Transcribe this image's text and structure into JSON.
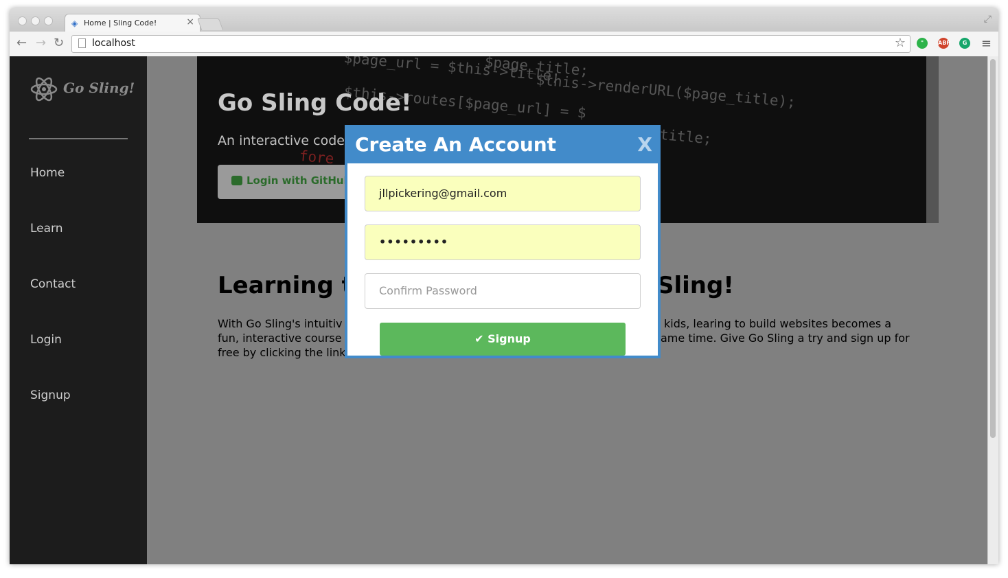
{
  "browser": {
    "tab_title": "Home | Sling Code!",
    "tab_close": "×",
    "url": "localhost",
    "extensions": [
      {
        "name": "hangouts-icon",
        "label": "",
        "color": "#2db34a"
      },
      {
        "name": "adblock-icon",
        "label": "ABP",
        "color": "#d0442c"
      },
      {
        "name": "grammarly-icon",
        "label": "",
        "color": "#15a66a"
      }
    ]
  },
  "sidebar": {
    "logo_text": "Go Sling!",
    "items": [
      {
        "label": "Home"
      },
      {
        "label": "Learn"
      },
      {
        "label": "Contact"
      },
      {
        "label": "Login"
      },
      {
        "label": "Signup"
      }
    ]
  },
  "hero": {
    "title": "Go Sling Code!",
    "subtitle": "An interactive code",
    "github_button": "Login with GitHub",
    "code_lines": [
      "$page_url = $this->title;",
      "$page_title;",
      "$this->renderURL($page_title);",
      "$this->routes[$page_url] = $",
      "title;",
      "fore"
    ]
  },
  "content": {
    "title_left": "Learning to",
    "title_right": "Sling!",
    "para_left": [
      "With Go Sling's intuitiv",
      "fun, interactive course",
      "free by clicking the link"
    ],
    "para_right": [
      "kids, learing to build websites becomes a",
      "ame time. Give Go Sling a try and sign up for"
    ]
  },
  "modal": {
    "title": "Create An Account",
    "close_label": "X",
    "email_value": "jllpickering@gmail.com",
    "password_value": "•••••••••",
    "confirm_placeholder": "Confirm Password",
    "signup_label": "Signup",
    "signup_icon": "✔"
  },
  "colors": {
    "accent": "#428bca",
    "success": "#5cb85c",
    "autofill": "#faffbd",
    "sidebar_bg": "#1c1c1c"
  }
}
